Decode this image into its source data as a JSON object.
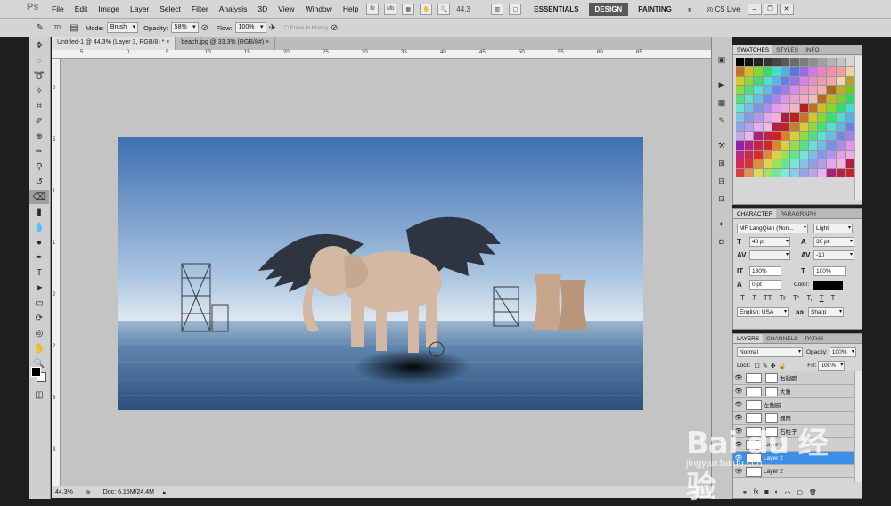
{
  "app": {
    "logo": "Ps"
  },
  "menu": [
    "File",
    "Edit",
    "Image",
    "Layer",
    "Select",
    "Filter",
    "Analysis",
    "3D",
    "View",
    "Window",
    "Help"
  ],
  "menubar": {
    "zoom": "44.3",
    "workspaces": [
      "ESSENTIALS",
      "DESIGN",
      "PAINTING"
    ],
    "active_workspace": "DESIGN",
    "more": "»",
    "cs_live": "CS Live"
  },
  "options": {
    "brush_size": "70",
    "mode_label": "Mode:",
    "mode_value": "Brush",
    "opacity_label": "Opacity:",
    "opacity_value": "58%",
    "flow_label": "Flow:",
    "flow_value": "100%",
    "erase_history": "Erase to History"
  },
  "doc_tabs": [
    {
      "label": "Untitled-1 @ 44.3% (Layer 3, RGB/8) *",
      "close": "×"
    },
    {
      "label": "beach.jpg @ 33.3% (RGB/8#)",
      "close": "×"
    }
  ],
  "rulers": {
    "top": [
      "5",
      "0",
      "5",
      "10",
      "15",
      "20",
      "25",
      "30",
      "35",
      "40",
      "45",
      "50",
      "55",
      "60",
      "65"
    ],
    "left": [
      "0",
      "5",
      "1",
      "1",
      "2",
      "2",
      "3",
      "3"
    ]
  },
  "status": {
    "zoom": "44.3%",
    "doc": "Doc: 6.15M/24.4M"
  },
  "panels": {
    "swatches_tabs": [
      "SWATCHES",
      "STYLES",
      "INFO"
    ],
    "character_tabs": [
      "CHARACTER",
      "PARAGRAPH"
    ],
    "layers_tabs": [
      "LAYERS",
      "CHANNELS",
      "PATHS"
    ]
  },
  "character": {
    "font_family": "MF LangQian (Non...",
    "font_style": "Light",
    "size": "48 pt",
    "leading": "30 pt",
    "kerning": "",
    "tracking": "-10",
    "vscale": "130%",
    "hscale": "100%",
    "baseline": "0 pt",
    "color_label": "Color:",
    "styles": [
      "T",
      "T",
      "TT",
      "Tr",
      "T¹",
      "T,",
      "T",
      "T"
    ],
    "language": "English: USA",
    "aa_icon": "aa",
    "antialias": "Sharp"
  },
  "layers": {
    "blend_mode": "Normal",
    "opacity_label": "Opacity:",
    "opacity": "100%",
    "lock_label": "Lock:",
    "fill_label": "Fill:",
    "fill": "100%",
    "rows": [
      {
        "name": "右翅膀",
        "selected": false
      },
      {
        "name": "大象",
        "selected": false
      },
      {
        "name": "左翅膀",
        "selected": false
      },
      {
        "name": "烟筒",
        "selected": false
      },
      {
        "name": "石柱子",
        "selected": false
      },
      {
        "name": "Layer 2",
        "selected": false
      },
      {
        "name": "Layer 2",
        "selected": true
      },
      {
        "name": "Layer 2",
        "selected": false
      }
    ]
  },
  "watermark": {
    "text": "Bai du 经验",
    "sub": "jingyan.baidu.com"
  },
  "colors": {
    "accent": "#3d8ee6",
    "workspace_active": "#585858"
  }
}
